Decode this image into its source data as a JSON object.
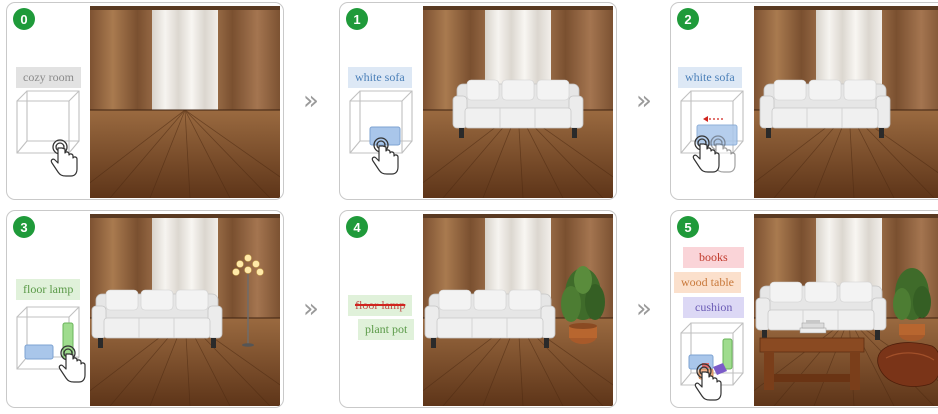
{
  "steps": [
    {
      "number": "0",
      "labels": [
        {
          "text": "cozy room",
          "bg": "#e2e2e2",
          "color": "#8a8a8a",
          "struck": false
        }
      ]
    },
    {
      "number": "1",
      "labels": [
        {
          "text": "white sofa",
          "bg": "#dde8f5",
          "color": "#4a7fb8",
          "struck": false
        }
      ]
    },
    {
      "number": "2",
      "labels": [
        {
          "text": "white sofa",
          "bg": "#dde8f5",
          "color": "#4a7fb8",
          "struck": false
        }
      ]
    },
    {
      "number": "3",
      "labels": [
        {
          "text": "floor lamp",
          "bg": "#e0f1da",
          "color": "#5a9a48",
          "struck": false
        }
      ]
    },
    {
      "number": "4",
      "labels": [
        {
          "text": "floor lamp",
          "bg": "#e0f1da",
          "color": "#c0504d",
          "struck": true
        },
        {
          "text": "plant pot",
          "bg": "#e0f1da",
          "color": "#5a9a48",
          "struck": false
        }
      ]
    },
    {
      "number": "5",
      "labels": [
        {
          "text": "books",
          "bg": "#fad4d8",
          "color": "#c0392b",
          "struck": false
        },
        {
          "text": "wood table",
          "bg": "#fbe0cc",
          "color": "#c8783a",
          "struck": false
        },
        {
          "text": "cushion",
          "bg": "#dcd8f5",
          "color": "#6b5bb5",
          "struck": false
        }
      ]
    }
  ],
  "arrows": [
    "»",
    "»",
    "»",
    "»"
  ],
  "colors": {
    "badge": "#1f9a3a",
    "floor": "#7a4a26",
    "curtain": "#9a6a42",
    "sheer": "#ece9e4",
    "sofa": "#e9e9e9"
  }
}
